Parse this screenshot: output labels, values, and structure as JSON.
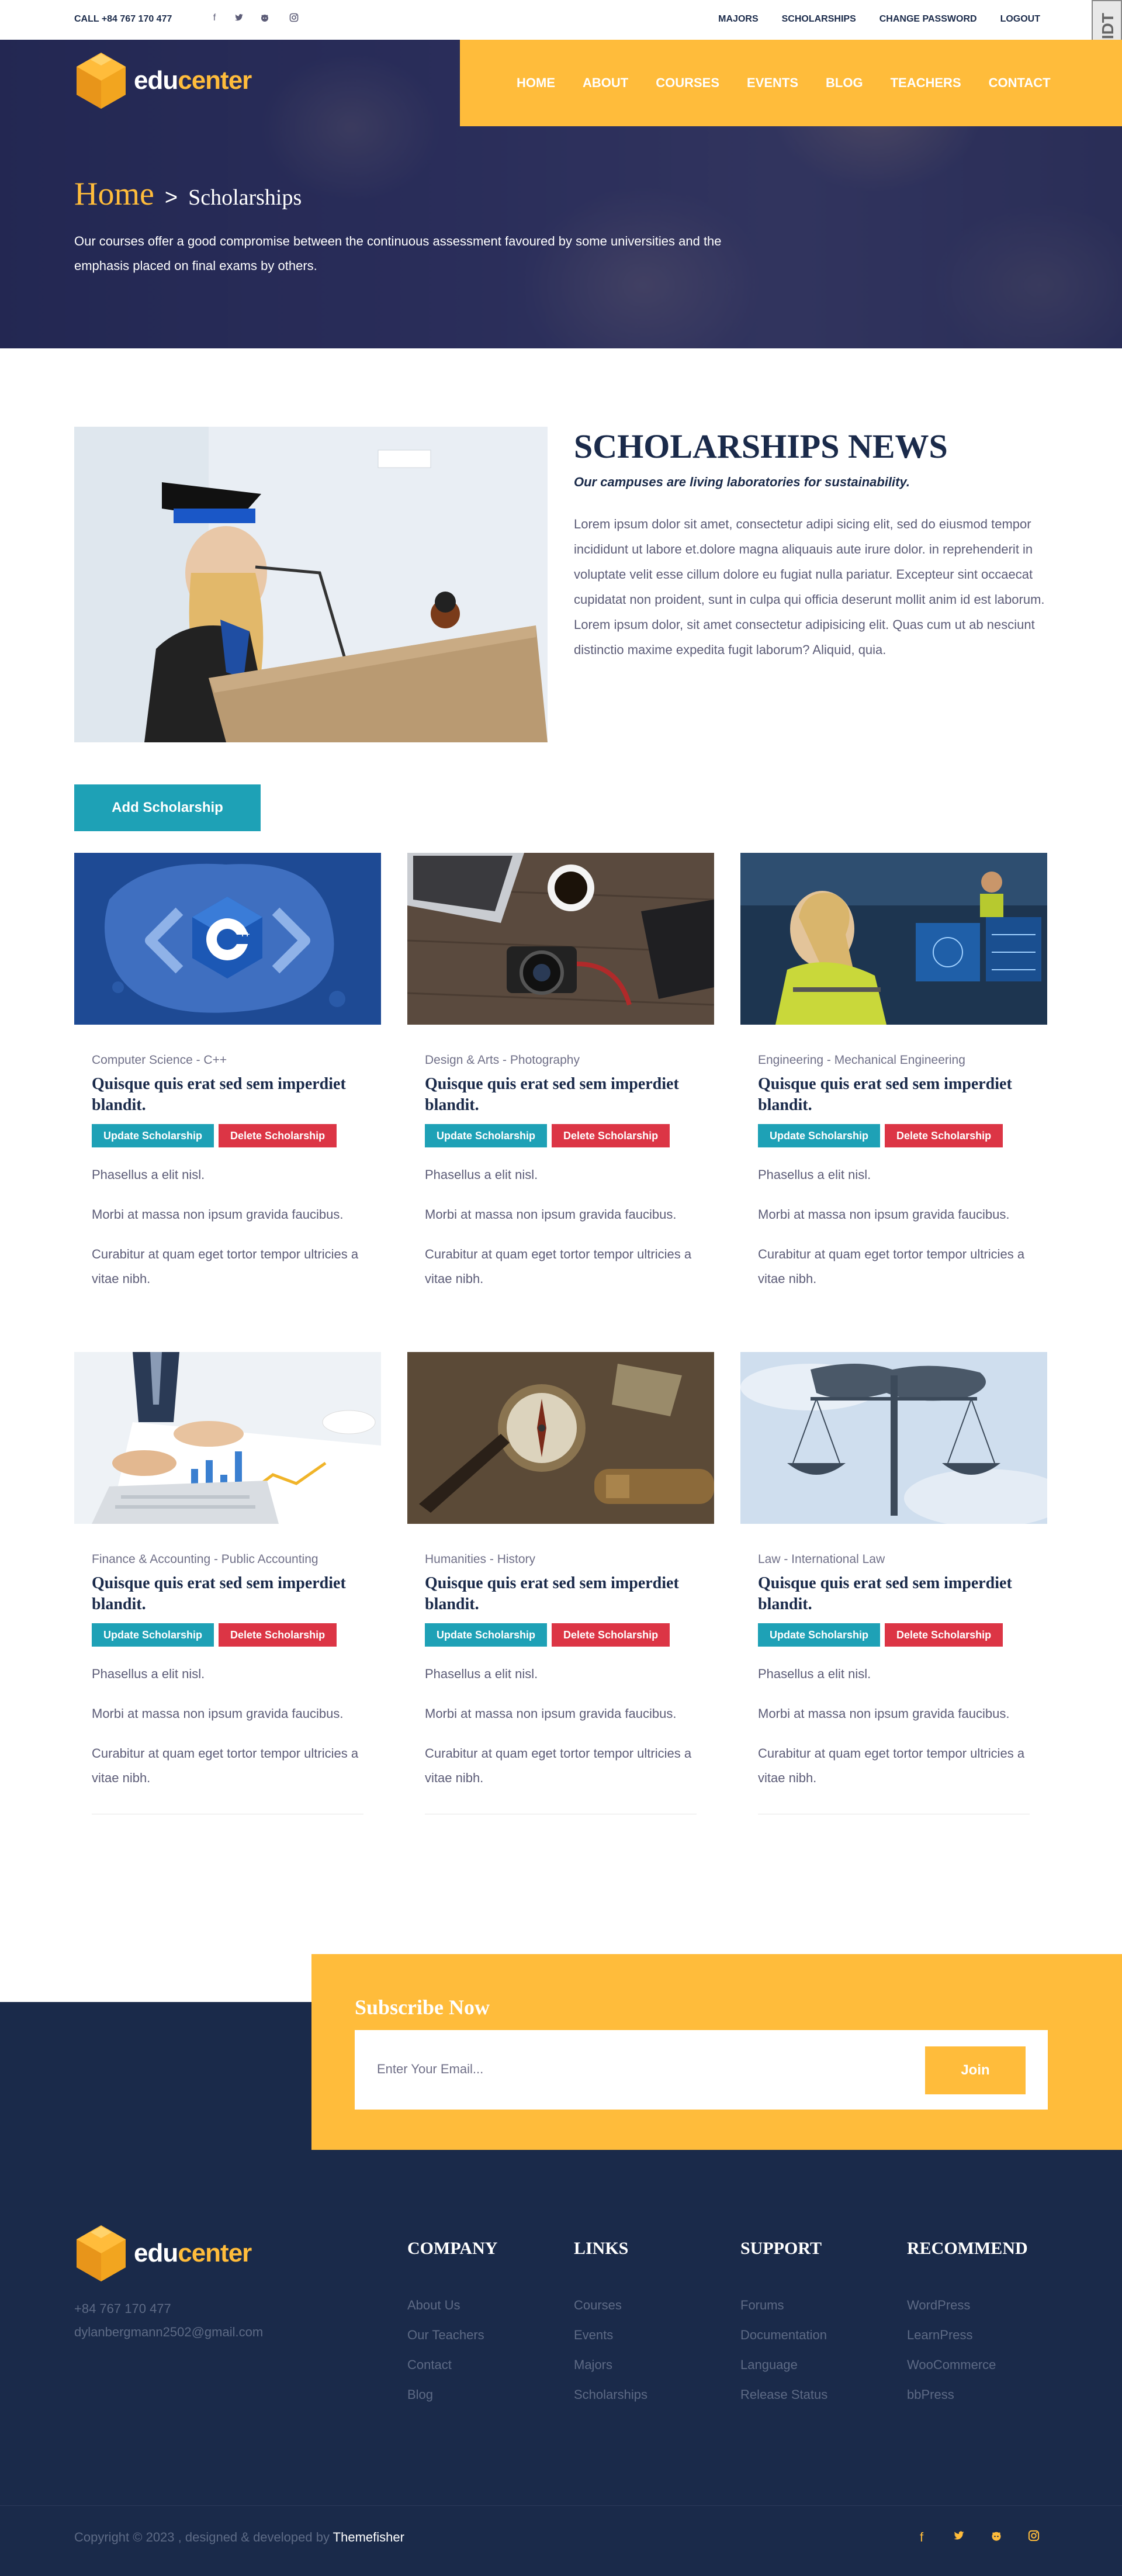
{
  "topbar": {
    "call": "CALL +84 767 170 477",
    "social": [
      "facebook-icon",
      "twitter-icon",
      "github-icon",
      "instagram-icon"
    ],
    "links": [
      "MAJORS",
      "SCHOLARSHIPS",
      "CHANGE PASSWORD",
      "LOGOUT"
    ],
    "badge": "DIDT"
  },
  "logo": {
    "edu": "edu",
    "center": "center"
  },
  "nav": [
    "HOME",
    "ABOUT",
    "COURSES",
    "EVENTS",
    "BLOG",
    "TEACHERS",
    "CONTACT"
  ],
  "hero": {
    "home": "Home",
    "separator": ">",
    "current": "Scholarships",
    "text": "Our courses offer a good compromise between the continuous assessment favoured by some universities and the emphasis placed on final exams by others."
  },
  "intro": {
    "title": "SCHOLARSHIPS NEWS",
    "subtitle": "Our campuses are living laboratories for sustainability.",
    "body": "Lorem ipsum dolor sit amet, consectetur adipi sicing elit, sed do eiusmod tempor incididunt ut labore et.dolore magna aliquauis aute irure dolor. in reprehenderit in voluptate velit esse cillum dolore eu fugiat nulla pariatur. Excepteur sint occaecat cupidatat non proident, sunt in culpa qui officia deserunt mollit anim id est laborum. Lorem ipsum dolor, sit amet consectetur adipisicing elit. Quas cum ut ab nesciunt distinctio maxime expedita fugit laborum? Aliquid, quia."
  },
  "add_button": "Add Scholarship",
  "cards": [
    {
      "category": "Computer Science - C++",
      "title": "Quisque quis erat sed sem imperdiet blandit.",
      "update": "Update Scholarship",
      "delete": "Delete Scholarship",
      "p1": "Phasellus a elit nisl.",
      "p2": "Morbi at massa non ipsum gravida faucibus.",
      "p3": "Curabitur at quam eget tortor tempor ultricies a vitae nibh."
    },
    {
      "category": "Design & Arts - Photography",
      "title": "Quisque quis erat sed sem imperdiet blandit.",
      "update": "Update Scholarship",
      "delete": "Delete Scholarship",
      "p1": "Phasellus a elit nisl.",
      "p2": "Morbi at massa non ipsum gravida faucibus.",
      "p3": "Curabitur at quam eget tortor tempor ultricies a vitae nibh."
    },
    {
      "category": "Engineering - Mechanical Engineering",
      "title": "Quisque quis erat sed sem imperdiet blandit.",
      "update": "Update Scholarship",
      "delete": "Delete Scholarship",
      "p1": "Phasellus a elit nisl.",
      "p2": "Morbi at massa non ipsum gravida faucibus.",
      "p3": "Curabitur at quam eget tortor tempor ultricies a vitae nibh."
    },
    {
      "category": "Finance & Accounting - Public Accounting",
      "title": "Quisque quis erat sed sem imperdiet blandit.",
      "update": "Update Scholarship",
      "delete": "Delete Scholarship",
      "p1": "Phasellus a elit nisl.",
      "p2": "Morbi at massa non ipsum gravida faucibus.",
      "p3": "Curabitur at quam eget tortor tempor ultricies a vitae nibh."
    },
    {
      "category": "Humanities - History",
      "title": "Quisque quis erat sed sem imperdiet blandit.",
      "update": "Update Scholarship",
      "delete": "Delete Scholarship",
      "p1": "Phasellus a elit nisl.",
      "p2": "Morbi at massa non ipsum gravida faucibus.",
      "p3": "Curabitur at quam eget tortor tempor ultricies a vitae nibh."
    },
    {
      "category": "Law - International Law",
      "title": "Quisque quis erat sed sem imperdiet blandit.",
      "update": "Update Scholarship",
      "delete": "Delete Scholarship",
      "p1": "Phasellus a elit nisl.",
      "p2": "Morbi at massa non ipsum gravida faucibus.",
      "p3": "Curabitur at quam eget tortor tempor ultricies a vitae nibh."
    }
  ],
  "subscribe": {
    "title": "Subscribe Now",
    "placeholder": "Enter Your Email...",
    "join": "Join"
  },
  "footer": {
    "phone": "+84 767 170 477",
    "email": "dylanbergmann2502@gmail.com",
    "columns": [
      {
        "title": "COMPANY",
        "links": [
          "About Us",
          "Our Teachers",
          "Contact",
          "Blog"
        ]
      },
      {
        "title": "LINKS",
        "links": [
          "Courses",
          "Events",
          "Majors",
          "Scholarships"
        ]
      },
      {
        "title": "SUPPORT",
        "links": [
          "Forums",
          "Documentation",
          "Language",
          "Release Status"
        ]
      },
      {
        "title": "RECOMMEND",
        "links": [
          "WordPress",
          "LearnPress",
          "WooCommerce",
          "bbPress"
        ]
      }
    ],
    "copyright": "Copyright © 2023 , designed & developed by",
    "brand": "Themefisher",
    "social": [
      "facebook-icon",
      "twitter-icon",
      "github-icon",
      "instagram-icon"
    ]
  },
  "colors": {
    "accent": "#ffbc3b",
    "navy": "#1a2a4a",
    "teal": "#1ea1b6",
    "red": "#dc3545"
  }
}
